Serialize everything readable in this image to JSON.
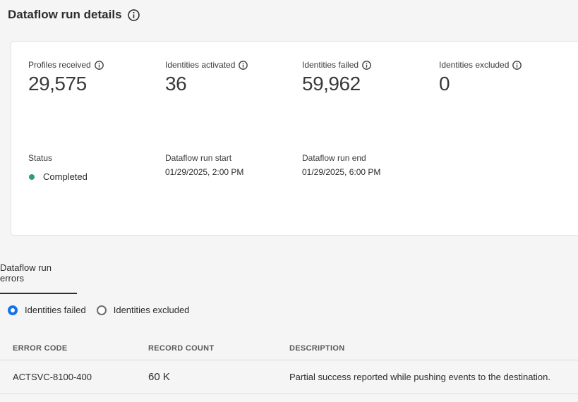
{
  "header": {
    "title": "Dataflow run details"
  },
  "metrics": [
    {
      "label": "Profiles received",
      "value": "29,575"
    },
    {
      "label": "Identities activated",
      "value": "36"
    },
    {
      "label": "Identities failed",
      "value": "59,962"
    },
    {
      "label": "Identities excluded",
      "value": "0"
    }
  ],
  "info": {
    "status_label": "Status",
    "status_value": "Completed",
    "status_color": "#2d9d78",
    "run_start_label": "Dataflow run start",
    "run_start_value": "01/29/2025, 2:00 PM",
    "run_end_label": "Dataflow run end",
    "run_end_value": "01/29/2025, 6:00 PM"
  },
  "tabs": [
    {
      "label": "Dataflow run errors",
      "selected": true
    }
  ],
  "radio": {
    "options": [
      {
        "label": "Identities failed",
        "checked": true
      },
      {
        "label": "Identities excluded",
        "checked": false
      }
    ],
    "accent": "#1473e6"
  },
  "table": {
    "headers": {
      "code": "ERROR CODE",
      "count": "RECORD COUNT",
      "description": "DESCRIPTION"
    },
    "rows": [
      {
        "code": "ACTSVC-8100-400",
        "count": "60 K",
        "description": "Partial success reported while pushing events to the destination."
      }
    ]
  }
}
